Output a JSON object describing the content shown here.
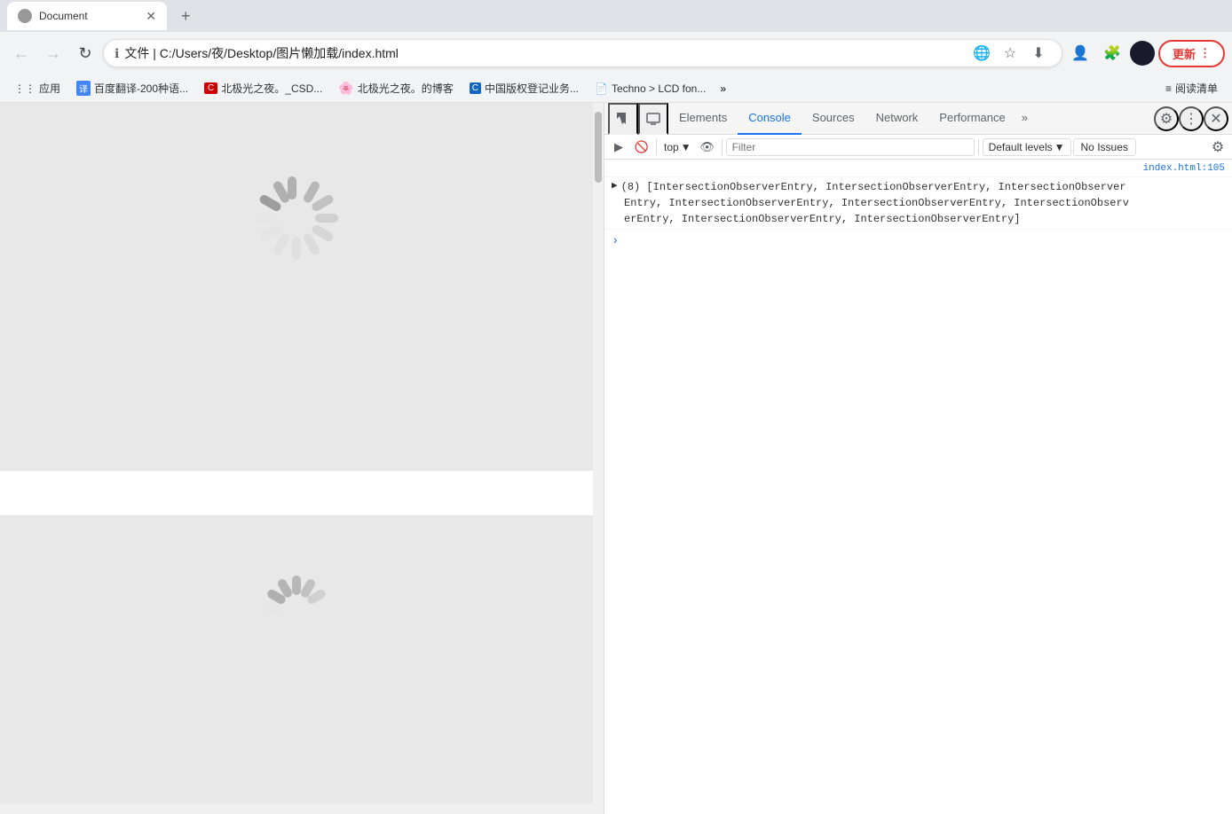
{
  "browser": {
    "tab": {
      "title": "Document",
      "active": true
    },
    "address": {
      "icon": "ℹ",
      "url": "C:/Users/夜/Desktop/图片懒加载/index.html",
      "protocol": "文件"
    },
    "update_btn": "更新",
    "bookmarks": [
      {
        "label": "应用",
        "icon": "⋮⋮"
      },
      {
        "label": "百度翻译-200种语...",
        "icon": "译"
      },
      {
        "label": "北极光之夜。_CSD...",
        "icon": "C"
      },
      {
        "label": "北极光之夜。的博客",
        "icon": "🟠"
      },
      {
        "label": "中国版权登记业务...",
        "icon": "C"
      },
      {
        "label": "Techno > LCD fon...",
        "icon": "📄"
      },
      {
        "label": "阅读清单",
        "icon": "≡"
      }
    ]
  },
  "devtools": {
    "tabs": [
      {
        "label": "Elements",
        "active": false
      },
      {
        "label": "Console",
        "active": true
      },
      {
        "label": "Sources",
        "active": false
      },
      {
        "label": "Network",
        "active": false
      },
      {
        "label": "Performance",
        "active": false
      }
    ],
    "toolbar": {
      "context_label": "top",
      "filter_placeholder": "Filter",
      "levels_label": "Default levels",
      "no_issues_label": "No Issues"
    },
    "console": {
      "source_link": "index.html:105",
      "line1": "(8) [IntersectionObserverEntry, IntersectionObserverEntry, IntersectionObserver",
      "line2": "Entry, IntersectionObserverEntry, IntersectionObserverEntry, IntersectionObserv",
      "line3": "erEntry, IntersectionObserverEntry, IntersectionObserverEntry]"
    }
  }
}
